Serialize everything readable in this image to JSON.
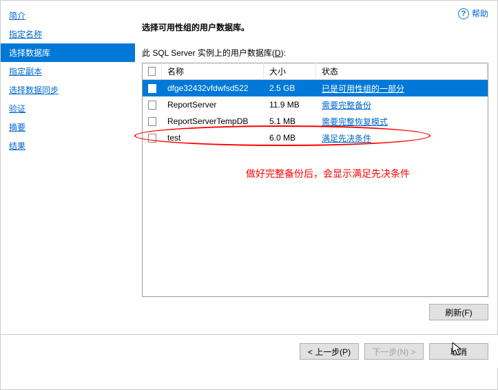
{
  "help": {
    "label": "帮助"
  },
  "sidebar": {
    "items": [
      {
        "label": "简介"
      },
      {
        "label": "指定名称"
      },
      {
        "label": "选择数据库"
      },
      {
        "label": "指定副本"
      },
      {
        "label": "选择数据同步"
      },
      {
        "label": "验证"
      },
      {
        "label": "摘要"
      },
      {
        "label": "结果"
      }
    ],
    "selected_index": 2
  },
  "main": {
    "heading": "选择可用性组的用户数据库。",
    "subheading_prefix": "此 SQL Server 实例上的用户数据库(",
    "subheading_hotkey": "D",
    "subheading_suffix": "):",
    "columns": {
      "name": "名称",
      "size": "大小",
      "status": "状态"
    },
    "rows": [
      {
        "name": "dfge32432vfdwfsd522",
        "size": "2.5 GB",
        "status": "已是可用性组的一部分",
        "selected": true
      },
      {
        "name": "ReportServer",
        "size": "11.9 MB",
        "status": "需要完整备份",
        "selected": false
      },
      {
        "name": "ReportServerTempDB",
        "size": "5.1 MB",
        "status": "需要完整恢复模式",
        "selected": false
      },
      {
        "name": "test",
        "size": "6.0 MB",
        "status": "满足先决条件",
        "selected": false
      }
    ],
    "annotation": "做好完整备份后，会显示满足先决条件",
    "refresh_label": "刷新(F)"
  },
  "footer": {
    "prev": "< 上一步(P)",
    "next": "下一步(N) >",
    "cancel": "取消"
  }
}
